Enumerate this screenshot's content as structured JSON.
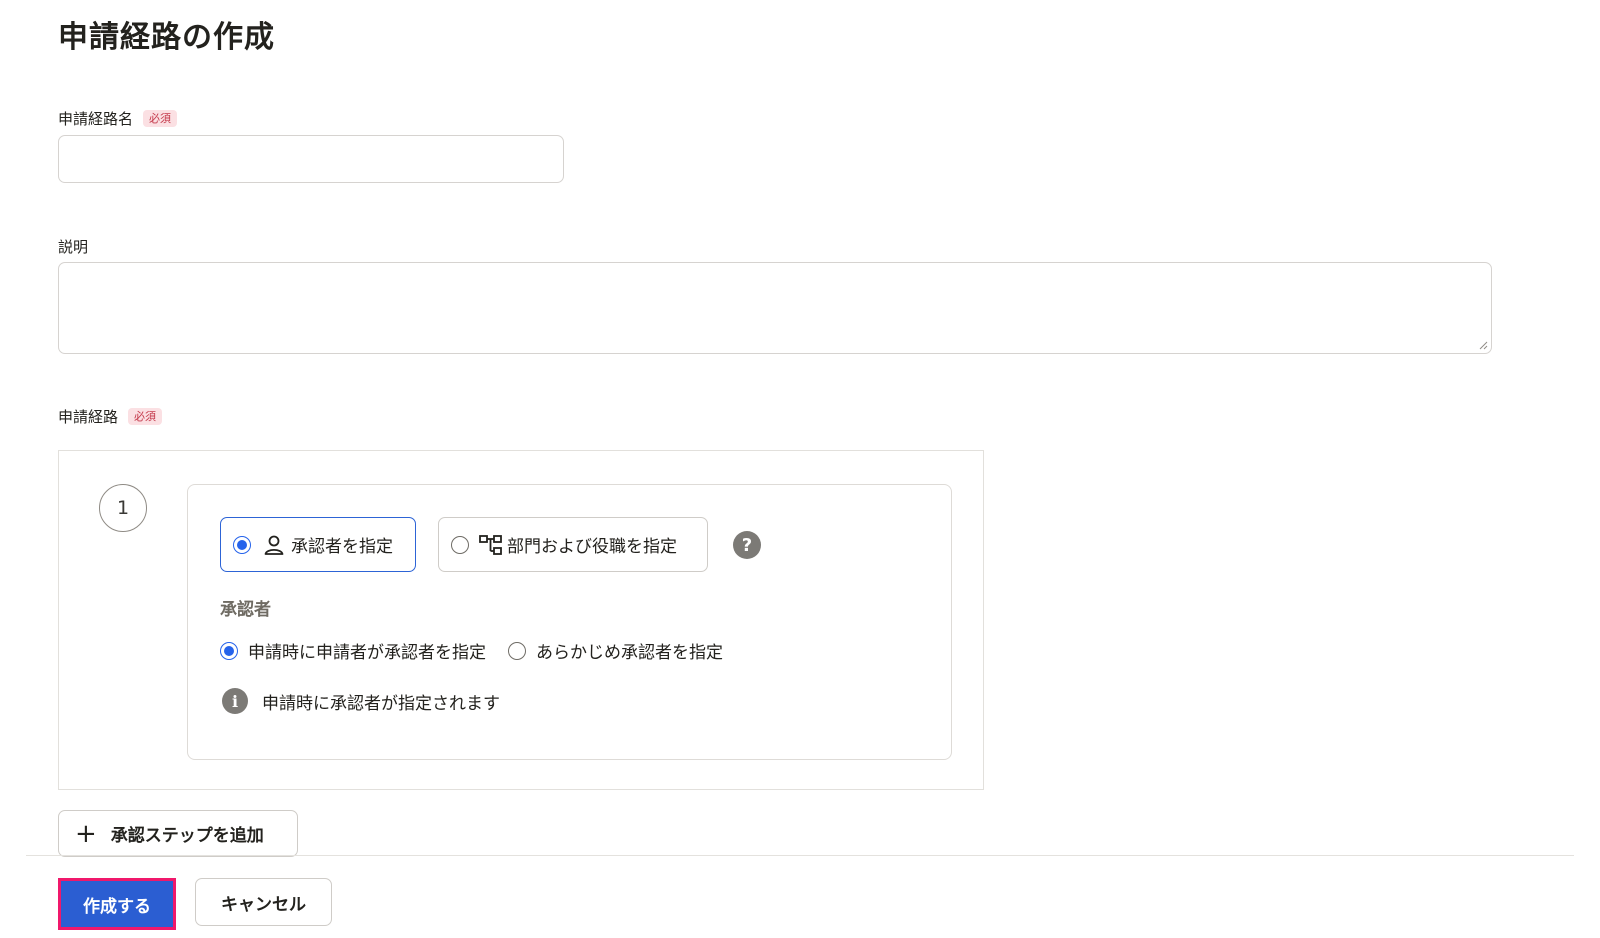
{
  "page": {
    "title": "申請経路の作成"
  },
  "form": {
    "name_field": {
      "label": "申請経路名",
      "required_badge": "必須",
      "value": "",
      "placeholder": ""
    },
    "description_field": {
      "label": "説明",
      "value": "",
      "placeholder": ""
    },
    "route_field": {
      "label": "申請経路",
      "required_badge": "必須"
    }
  },
  "route": {
    "steps": [
      {
        "number": "1",
        "mode_options": [
          {
            "label": "承認者を指定",
            "icon": "person-icon",
            "selected": true
          },
          {
            "label": "部門および役職を指定",
            "icon": "org-chart-icon",
            "selected": false
          }
        ],
        "help_icon": "?",
        "approver_section": {
          "label": "承認者",
          "options": [
            {
              "label": "申請時に申請者が承認者を指定",
              "selected": true
            },
            {
              "label": "あらかじめ承認者を指定",
              "selected": false
            }
          ],
          "info_glyph": "i",
          "info_text": "申請時に承認者が指定されます"
        }
      }
    ],
    "add_step_label": "承認ステップを追加"
  },
  "footer": {
    "create_label": "作成する",
    "cancel_label": "キャンセル"
  },
  "colors": {
    "accent": "#2563eb",
    "primary_button": "#2b5ed2",
    "highlight_outline": "#f0186b",
    "required_badge_bg": "#fbe0e3",
    "required_badge_text": "#c4394b"
  }
}
